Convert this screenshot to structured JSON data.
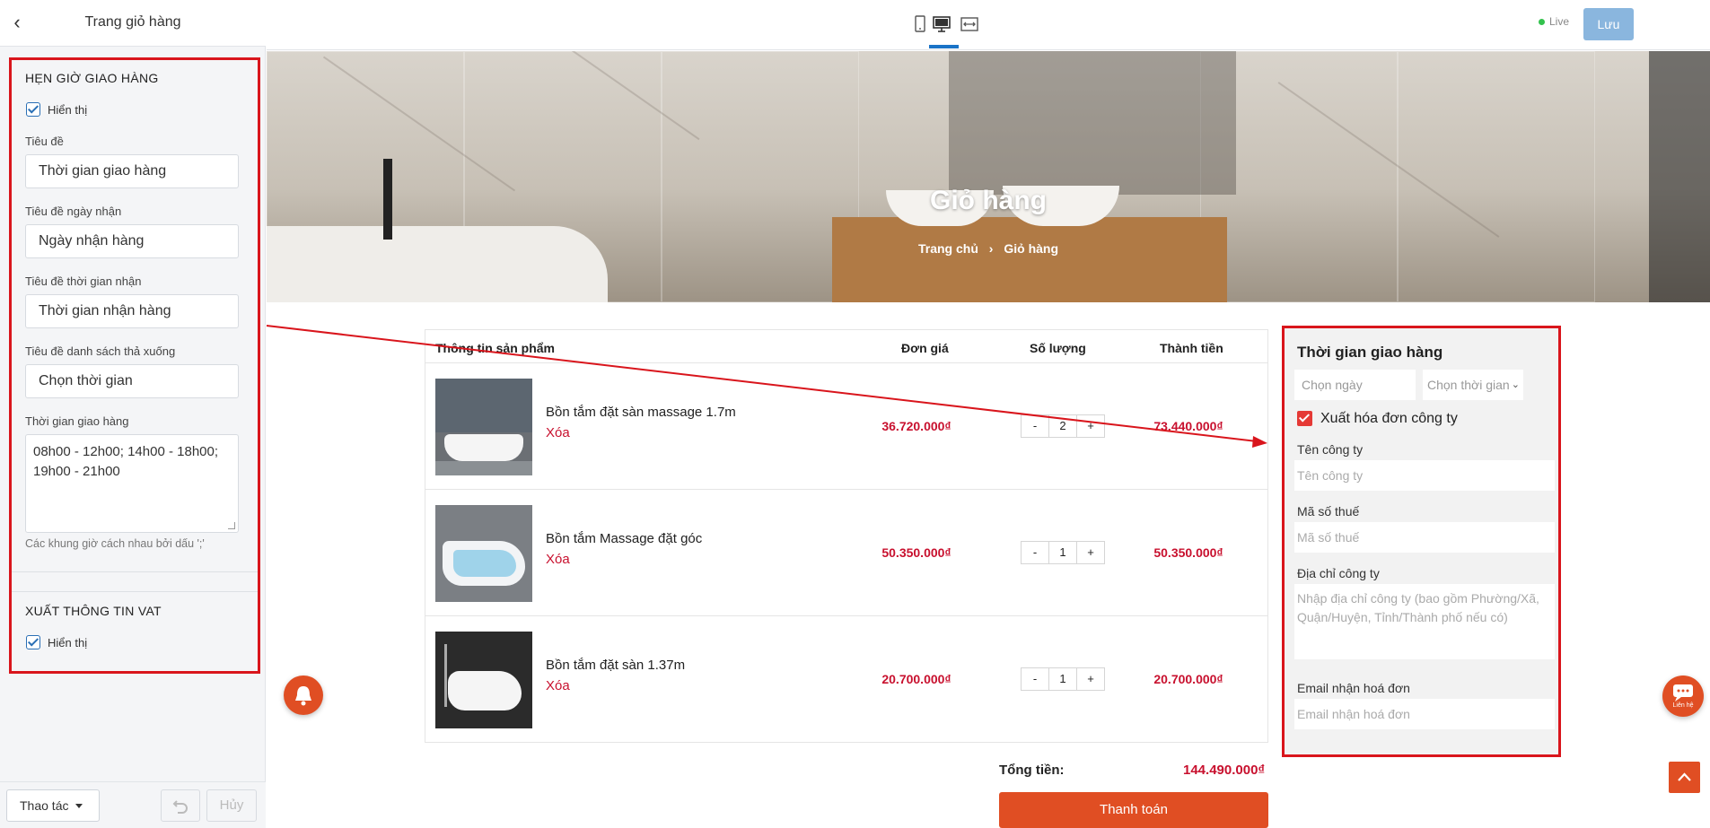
{
  "sidebar": {
    "title": "Trang giỏ hàng",
    "delivery_section": {
      "heading": "HẸN GIỜ GIAO HÀNG",
      "show_label": "Hiển thị",
      "fields": [
        {
          "label": "Tiêu đề",
          "value": "Thời gian giao hàng"
        },
        {
          "label": "Tiêu đề ngày nhận",
          "value": "Ngày nhận hàng"
        },
        {
          "label": "Tiêu đề thời gian nhận",
          "value": "Thời gian nhận hàng"
        },
        {
          "label": "Tiêu đề danh sách thả xuống",
          "value": "Chọn thời gian"
        }
      ],
      "slots_label": "Thời gian giao hàng",
      "slots_value": "08h00 - 12h00; 14h00 - 18h00; 19h00 - 21h00",
      "hint": "Các khung giờ cách nhau bởi dấu ';'"
    },
    "vat_section": {
      "heading": "XUẤT THÔNG TIN VAT",
      "show_label": "Hiển thị"
    },
    "footer": {
      "actions_label": "Thao tác",
      "cancel_label": "Hủy"
    }
  },
  "topbar": {
    "live_label": "Live",
    "save_label": "Lưu",
    "devices": [
      "mobile-icon",
      "desktop-icon",
      "fullwidth-icon"
    ],
    "active_device": "desktop-icon"
  },
  "banner": {
    "title": "Giỏ hàng",
    "breadcrumb_home": "Trang chủ",
    "breadcrumb_current": "Giỏ hàng"
  },
  "cart": {
    "headers": [
      "Thông tin sản phẩm",
      "Đơn giá",
      "Số lượng",
      "Thành tiền"
    ],
    "items": [
      {
        "name": "Bồn tắm đặt sàn massage 1.7m",
        "delete": "Xóa",
        "price": "36.720.000₫",
        "qty": "2",
        "total": "73.440.000₫"
      },
      {
        "name": "Bồn tắm Massage đặt góc",
        "delete": "Xóa",
        "price": "50.350.000₫",
        "qty": "1",
        "total": "50.350.000₫"
      },
      {
        "name": "Bồn tắm đặt sàn 1.37m",
        "delete": "Xóa",
        "price": "20.700.000₫",
        "qty": "1",
        "total": "20.700.000₫"
      }
    ],
    "minus": "-",
    "plus": "+",
    "sum_label": "Tổng tiền:",
    "sum_value": "144.490.000₫",
    "checkout_label": "Thanh toán"
  },
  "delivery_panel": {
    "title": "Thời gian giao hàng",
    "date_placeholder": "Chọn ngày",
    "time_placeholder": "Chọn thời gian",
    "vat_label": "Xuất hóa đơn công ty",
    "company_label": "Tên công ty",
    "company_placeholder": "Tên công ty",
    "tax_label": "Mã số thuế",
    "tax_placeholder": "Mã số thuế",
    "address_label": "Địa chỉ công ty",
    "address_placeholder": "Nhập địa chỉ công ty (bao gồm Phường/Xã, Quận/Huyện, Tỉnh/Thành phố nếu có)",
    "email_label": "Email nhận hoá đơn",
    "email_placeholder": "Email nhận hoá đơn"
  },
  "floating": {
    "chat_label": "Liên hệ"
  },
  "colors": {
    "accent": "#e04e23",
    "price_red": "#c8102e",
    "highlight_border": "#d9151c",
    "save_button": "#8ab6de",
    "link_blue": "#1a73c7"
  }
}
